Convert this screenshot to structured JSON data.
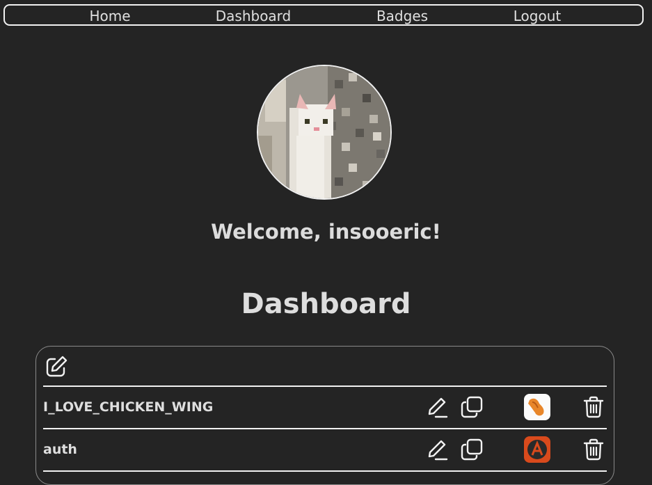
{
  "nav": {
    "links": [
      {
        "label": "Home"
      },
      {
        "label": "Dashboard"
      },
      {
        "label": "Badges"
      },
      {
        "label": "Logout"
      }
    ]
  },
  "profile": {
    "welcome": "Welcome, insooeric!"
  },
  "dashboard": {
    "title": "Dashboard",
    "items": [
      {
        "name": "I_LOVE_CHICKEN_WING",
        "badge_icon": "chicken-wing-icon",
        "badge_color": "#e8862a"
      },
      {
        "name": "auth",
        "badge_icon": "emblem-a-icon",
        "badge_color": "#d94a1c"
      }
    ]
  },
  "colors": {
    "background": "#242424",
    "text": "#dedede",
    "border": "#f2f2f2"
  }
}
